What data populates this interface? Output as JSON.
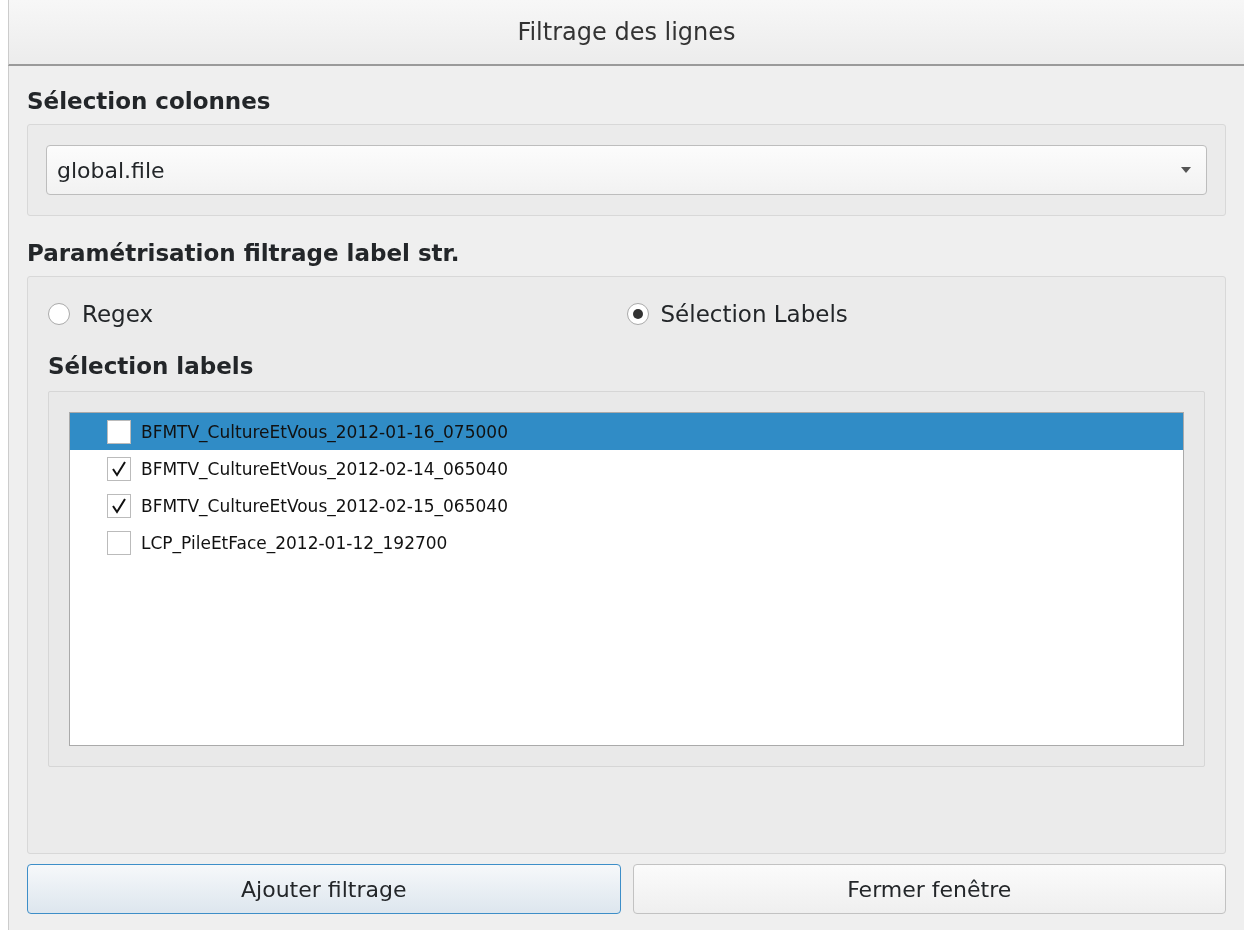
{
  "window": {
    "title": "Filtrage des lignes"
  },
  "column_section": {
    "title": "Sélection colonnes",
    "combo": {
      "value": "global.file"
    }
  },
  "filter_section": {
    "title": "Paramétrisation filtrage label str.",
    "modes": [
      {
        "label": "Regex",
        "selected": false
      },
      {
        "label": "Sélection Labels",
        "selected": true
      }
    ],
    "labels_title": "Sélection labels",
    "labels": [
      {
        "text": "BFMTV_CultureEtVous_2012-01-16_075000",
        "checked": false,
        "selected": true
      },
      {
        "text": "BFMTV_CultureEtVous_2012-02-14_065040",
        "checked": true,
        "selected": false
      },
      {
        "text": "BFMTV_CultureEtVous_2012-02-15_065040",
        "checked": true,
        "selected": false
      },
      {
        "text": "LCP_PileEtFace_2012-01-12_192700",
        "checked": false,
        "selected": false
      }
    ]
  },
  "buttons": [
    {
      "label": "Ajouter filtrage",
      "focused": true
    },
    {
      "label": "Fermer fenêtre",
      "focused": false
    }
  ]
}
